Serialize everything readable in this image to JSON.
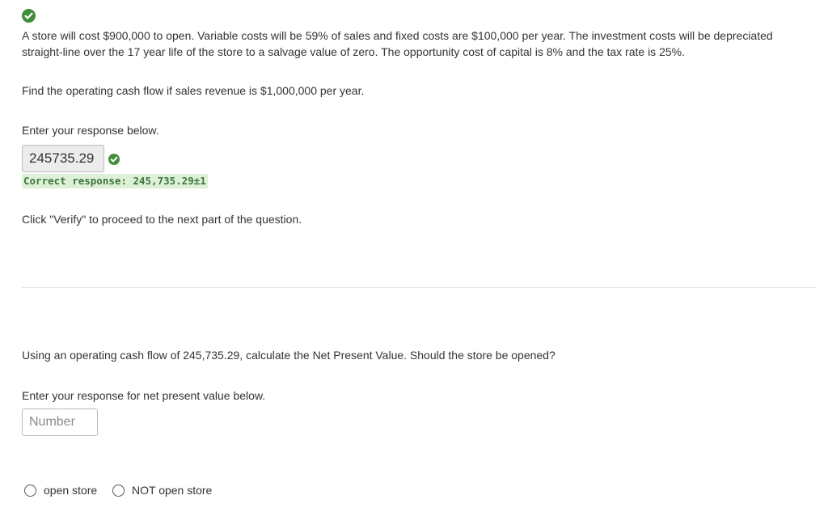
{
  "question": {
    "problem_text": "A store will cost $900,000 to open. Variable costs will be 59% of sales and fixed costs are $100,000 per year. The investment costs will be depreciated straight-line over the 17 year life of the store to a salvage value of zero. The opportunity cost of capital is 8% and the tax rate is 25%.",
    "part1_prompt": "Find the operating cash flow if sales revenue is $1,000,000 per year.",
    "part1_enter_label": "Enter your response below.",
    "part1_answer_value": "245735.29",
    "part1_correct_response": "Correct response: 245,735.29±1",
    "verify_instruction": "Click \"Verify\" to proceed to the next part of the question.",
    "part2_prompt": "Using an operating cash flow of 245,735.29, calculate the Net Present Value. Should the store be opened?",
    "part2_enter_label": "Enter your response for net present value below.",
    "npv_input_placeholder": "Number",
    "npv_input_value": "",
    "options": [
      {
        "label": "open store",
        "selected": false
      },
      {
        "label": "NOT open store",
        "selected": false
      }
    ]
  },
  "icons": {
    "top_status": "check-circle-icon",
    "answer_status": "check-circle-icon"
  },
  "colors": {
    "success_green": "#3f8f3a",
    "correct_bg": "#dff0d8",
    "correct_text": "#3c763d",
    "text": "#333333"
  }
}
